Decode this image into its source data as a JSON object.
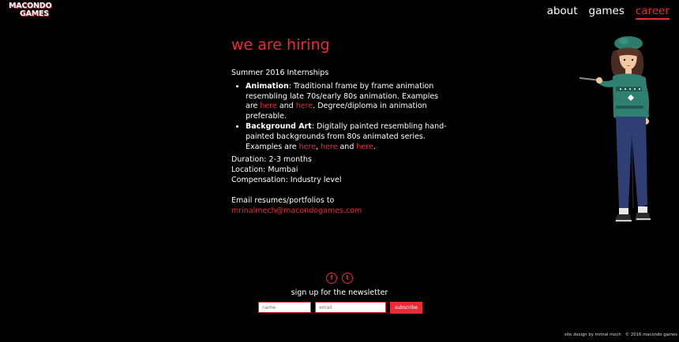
{
  "brand": {
    "line1": "MACONDO",
    "line2": "GAMES"
  },
  "nav": [
    {
      "label": "about"
    },
    {
      "label": "games"
    },
    {
      "label": "career",
      "active": true
    }
  ],
  "page": {
    "title": "we are hiring",
    "subtitle": "Summer 2016 Internships",
    "positions": [
      {
        "name": "Animation",
        "desc": ": Traditional frame by frame animation resembling late 70s/early 80s animation. Examples are ",
        "link1": "here",
        "and": " and ",
        "link2": "here",
        "tail": ". Degree/diploma in animation preferable."
      },
      {
        "name": "Background Art",
        "desc": ": Digitally painted resembling hand-painted backgrounds from 80s animated series. Examples are ",
        "link1": "here",
        "comma": ", ",
        "link2": "here",
        "and": " and ",
        "link3": "here",
        "tail": "."
      }
    ],
    "duration": "Duration: 2-3 months",
    "location": "Location: Mumbai",
    "compensation": "Compensation: Industry level",
    "email_intro": "Email resumes/portfolios to",
    "email": "mrinalmech@macondogames.com"
  },
  "footer": {
    "social": [
      "facebook-icon",
      "twitter-icon"
    ],
    "facebook_glyph": "f",
    "twitter_glyph": "t",
    "signup": "sign up for the newsletter",
    "name_placeholder": "name",
    "email_placeholder": "email",
    "subscribe": "subscribe",
    "credit": "site design by mrinal mech",
    "copyright": "© 2016 macondo games"
  },
  "colors": {
    "accent": "#ec2b36",
    "background": "#000000"
  }
}
